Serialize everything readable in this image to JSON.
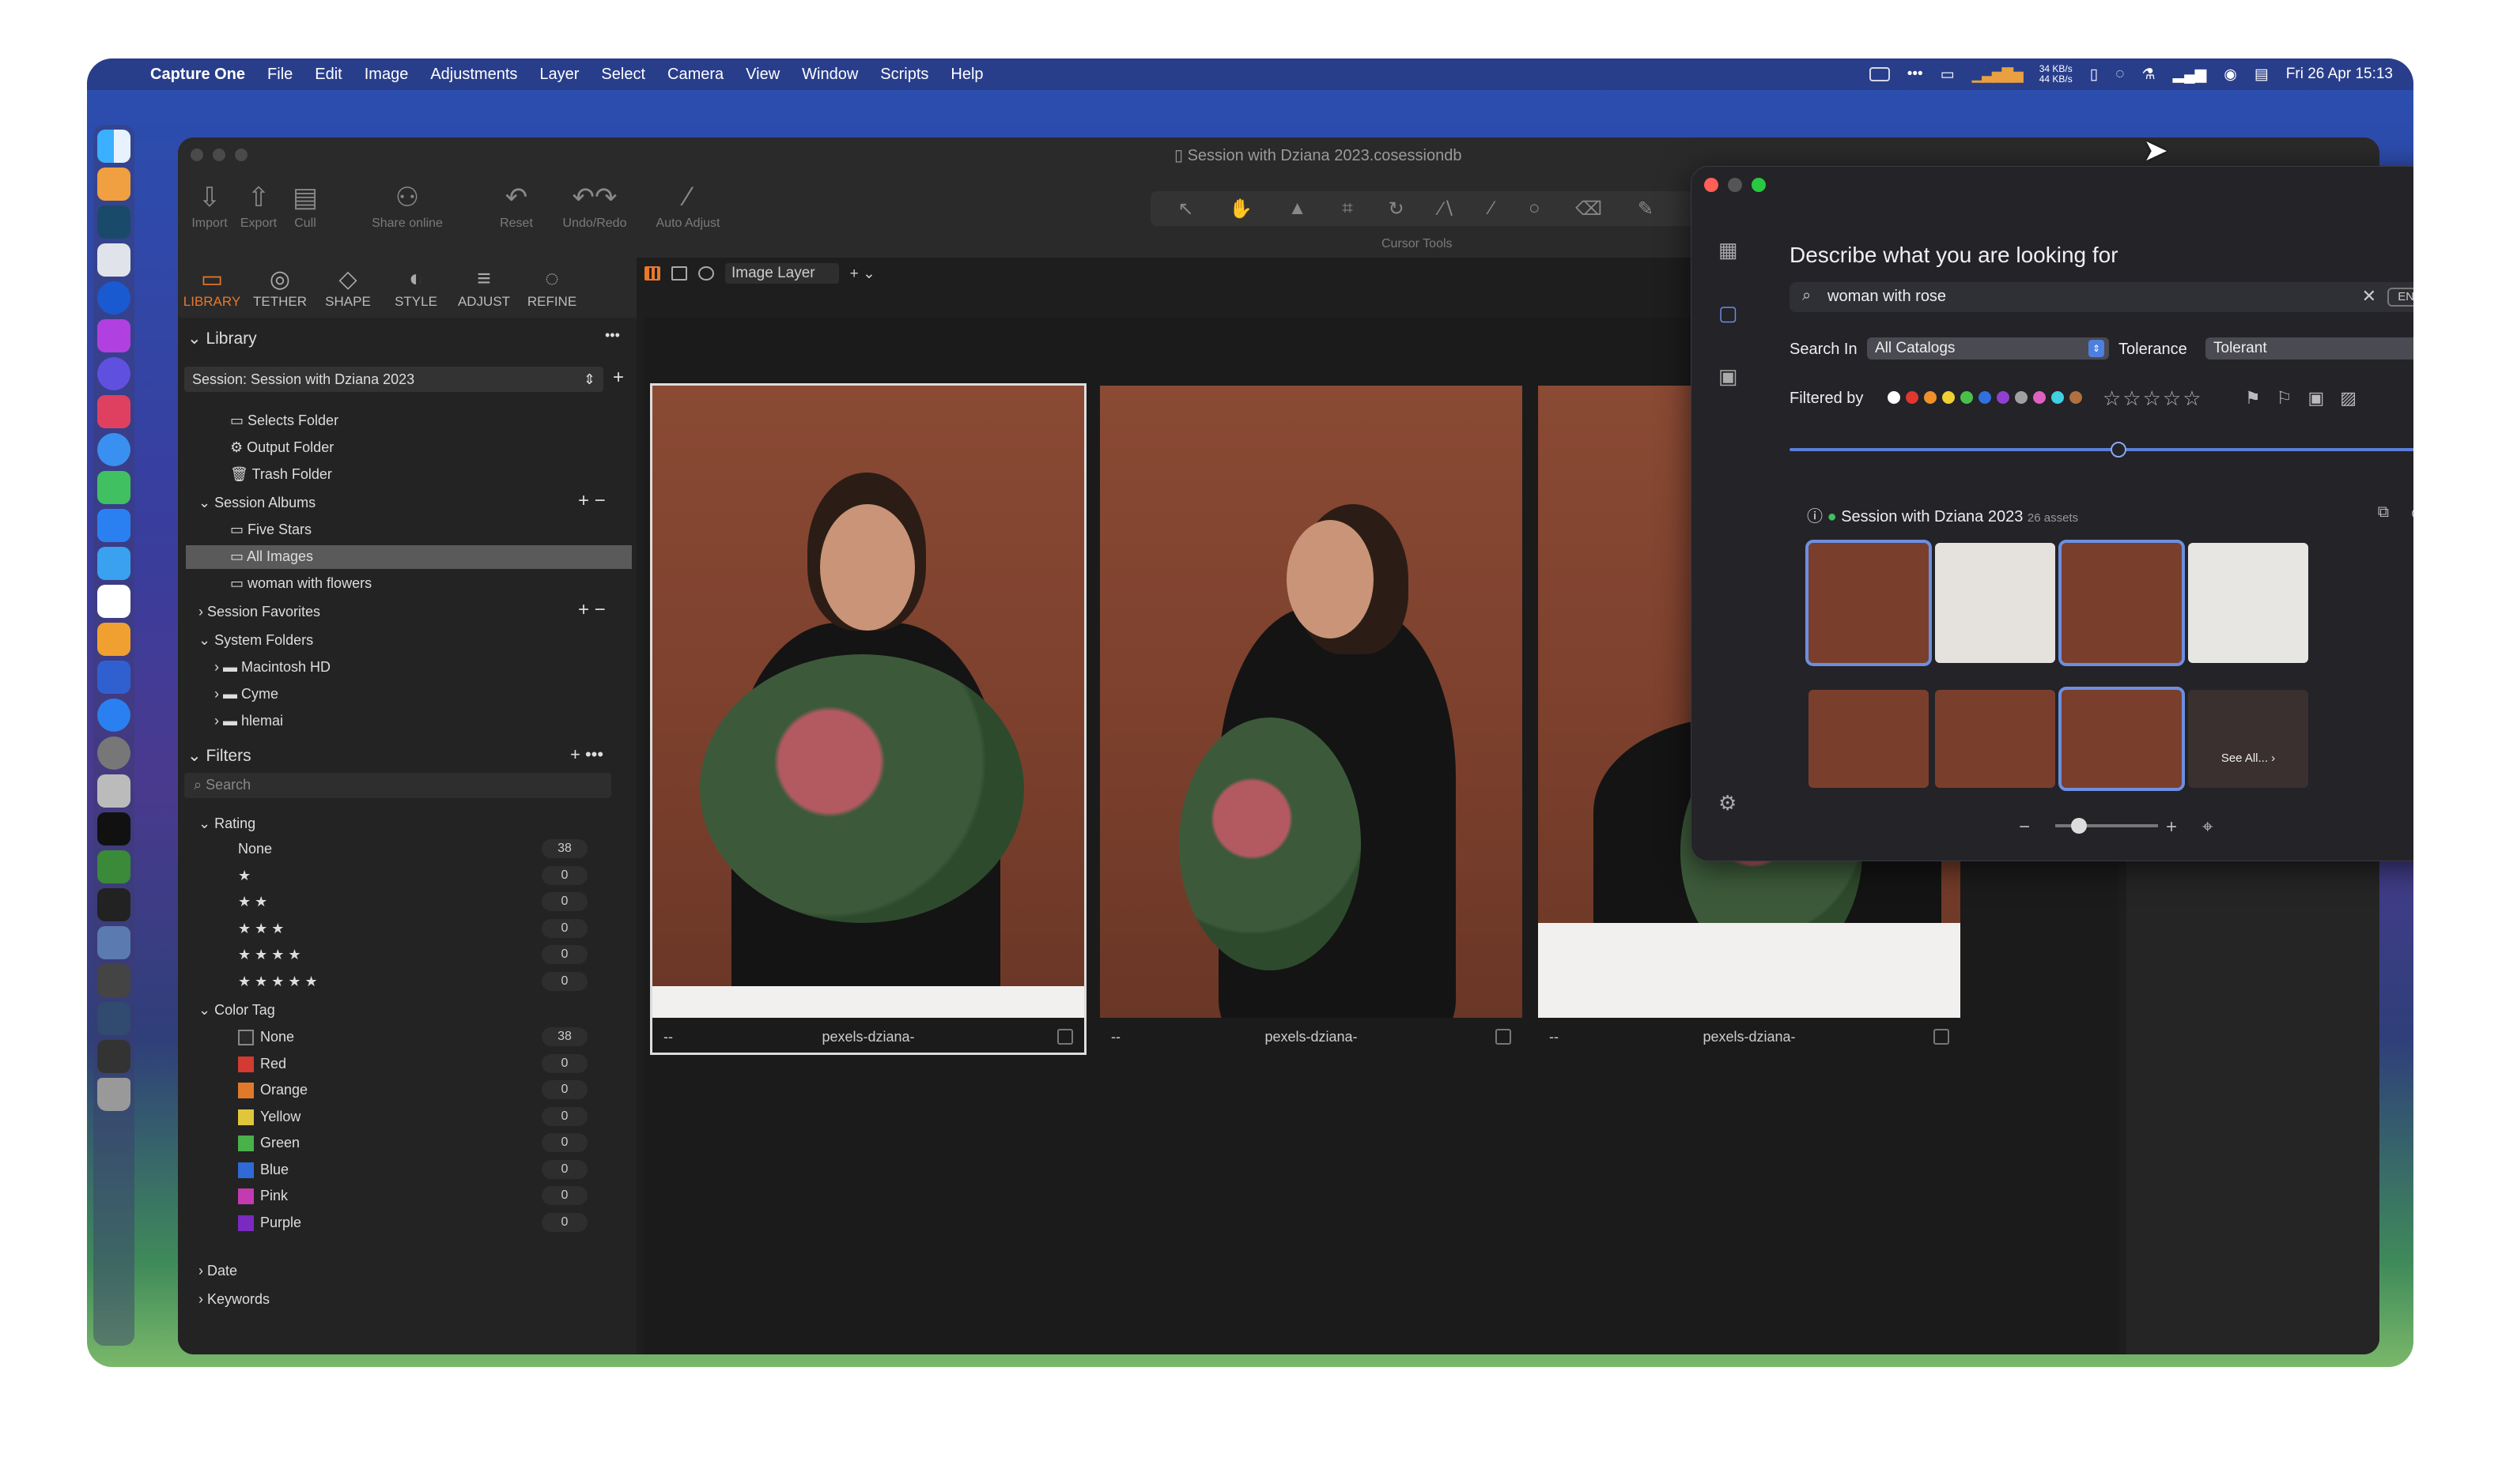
{
  "menubar": {
    "app": "Capture One",
    "items": [
      "File",
      "Edit",
      "Image",
      "Adjustments",
      "Layer",
      "Select",
      "Camera",
      "View",
      "Window",
      "Scripts",
      "Help"
    ],
    "net_up": "34 KB/s",
    "net_down": "44 KB/s",
    "clock": "Fri 26 Apr  15:13"
  },
  "window": {
    "title": "Session with Dziana 2023.cosessiondb"
  },
  "toolbar": {
    "import": "Import",
    "export": "Export",
    "cull": "Cull",
    "share": "Share online",
    "reset": "Reset",
    "undo_redo": "Undo/Redo",
    "auto_adjust": "Auto Adjust",
    "cursor_tools": "Cursor Tools"
  },
  "tool_tabs": [
    "LIBRARY",
    "TETHER",
    "SHAPE",
    "STYLE",
    "ADJUST",
    "REFINE"
  ],
  "viewbar": {
    "layer": "Image Layer"
  },
  "library": {
    "heading": "Library",
    "session": "Session: Session with Dziana 2023",
    "folders": [
      "Selects Folder",
      "Output Folder",
      "Trash Folder"
    ],
    "albums_heading": "Session Albums",
    "albums": [
      "Five Stars",
      "All Images",
      "woman with flowers"
    ],
    "favorites_heading": "Session Favorites",
    "system_heading": "System Folders",
    "system": [
      "Macintosh HD",
      "Cyme",
      "hlemai"
    ]
  },
  "filters": {
    "heading": "Filters",
    "search_placeholder": "Search",
    "rating_heading": "Rating",
    "ratings": [
      {
        "label": "None",
        "count": "38"
      },
      {
        "label": "★",
        "count": "0"
      },
      {
        "label": "★ ★",
        "count": "0"
      },
      {
        "label": "★ ★ ★",
        "count": "0"
      },
      {
        "label": "★ ★ ★ ★",
        "count": "0"
      },
      {
        "label": "★ ★ ★ ★ ★",
        "count": "0"
      }
    ],
    "color_heading": "Color Tag",
    "colors": [
      {
        "label": "None",
        "count": "38",
        "color": "#2a2a2a"
      },
      {
        "label": "Red",
        "count": "0",
        "color": "#d23a32"
      },
      {
        "label": "Orange",
        "count": "0",
        "color": "#e07a2a"
      },
      {
        "label": "Yellow",
        "count": "0",
        "color": "#e0c63a"
      },
      {
        "label": "Green",
        "count": "0",
        "color": "#4ab04a"
      },
      {
        "label": "Blue",
        "count": "0",
        "color": "#2f6ad6"
      },
      {
        "label": "Pink",
        "count": "0",
        "color": "#c43ab0"
      },
      {
        "label": "Purple",
        "count": "0",
        "color": "#7a2ac0"
      }
    ],
    "date": "Date",
    "keywords": "Keywords"
  },
  "viewer": {
    "captions": [
      "pexels-dziana-",
      "pexels-dziana-",
      "pexels-dziana-"
    ],
    "dash": "--"
  },
  "search_panel": {
    "title": "Describe what you are looking for",
    "query": "woman with rose",
    "lang": "EN",
    "search_in_label": "Search In",
    "search_in": "All Catalogs",
    "tolerance_label": "Tolerance",
    "tolerance": "Tolerant",
    "filtered_by": "Filtered by",
    "filter_colors": [
      "#ffffff",
      "#e0372e",
      "#f0902a",
      "#f0d030",
      "#4ac04a",
      "#3070e0",
      "#9040d0",
      "#a0a0a0",
      "#e060c0",
      "#40d0e0",
      "#b07040"
    ],
    "stars": "☆☆☆☆☆",
    "session_name": "Session with Dziana 2023",
    "session_count": "26 assets",
    "see_all": "See All...",
    "accent": "#6d8fe0"
  }
}
